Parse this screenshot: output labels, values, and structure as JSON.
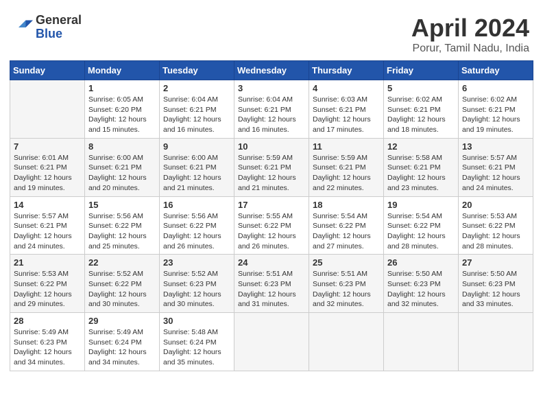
{
  "header": {
    "logo_general": "General",
    "logo_blue": "Blue",
    "month_title": "April 2024",
    "location": "Porur, Tamil Nadu, India"
  },
  "calendar": {
    "days_of_week": [
      "Sunday",
      "Monday",
      "Tuesday",
      "Wednesday",
      "Thursday",
      "Friday",
      "Saturday"
    ],
    "weeks": [
      {
        "cells": [
          {
            "day": "",
            "empty": true
          },
          {
            "day": "1",
            "sunrise": "Sunrise: 6:05 AM",
            "sunset": "Sunset: 6:20 PM",
            "daylight": "Daylight: 12 hours and 15 minutes."
          },
          {
            "day": "2",
            "sunrise": "Sunrise: 6:04 AM",
            "sunset": "Sunset: 6:21 PM",
            "daylight": "Daylight: 12 hours and 16 minutes."
          },
          {
            "day": "3",
            "sunrise": "Sunrise: 6:04 AM",
            "sunset": "Sunset: 6:21 PM",
            "daylight": "Daylight: 12 hours and 16 minutes."
          },
          {
            "day": "4",
            "sunrise": "Sunrise: 6:03 AM",
            "sunset": "Sunset: 6:21 PM",
            "daylight": "Daylight: 12 hours and 17 minutes."
          },
          {
            "day": "5",
            "sunrise": "Sunrise: 6:02 AM",
            "sunset": "Sunset: 6:21 PM",
            "daylight": "Daylight: 12 hours and 18 minutes."
          },
          {
            "day": "6",
            "sunrise": "Sunrise: 6:02 AM",
            "sunset": "Sunset: 6:21 PM",
            "daylight": "Daylight: 12 hours and 19 minutes."
          }
        ]
      },
      {
        "cells": [
          {
            "day": "7",
            "sunrise": "Sunrise: 6:01 AM",
            "sunset": "Sunset: 6:21 PM",
            "daylight": "Daylight: 12 hours and 19 minutes."
          },
          {
            "day": "8",
            "sunrise": "Sunrise: 6:00 AM",
            "sunset": "Sunset: 6:21 PM",
            "daylight": "Daylight: 12 hours and 20 minutes."
          },
          {
            "day": "9",
            "sunrise": "Sunrise: 6:00 AM",
            "sunset": "Sunset: 6:21 PM",
            "daylight": "Daylight: 12 hours and 21 minutes."
          },
          {
            "day": "10",
            "sunrise": "Sunrise: 5:59 AM",
            "sunset": "Sunset: 6:21 PM",
            "daylight": "Daylight: 12 hours and 21 minutes."
          },
          {
            "day": "11",
            "sunrise": "Sunrise: 5:59 AM",
            "sunset": "Sunset: 6:21 PM",
            "daylight": "Daylight: 12 hours and 22 minutes."
          },
          {
            "day": "12",
            "sunrise": "Sunrise: 5:58 AM",
            "sunset": "Sunset: 6:21 PM",
            "daylight": "Daylight: 12 hours and 23 minutes."
          },
          {
            "day": "13",
            "sunrise": "Sunrise: 5:57 AM",
            "sunset": "Sunset: 6:21 PM",
            "daylight": "Daylight: 12 hours and 24 minutes."
          }
        ]
      },
      {
        "cells": [
          {
            "day": "14",
            "sunrise": "Sunrise: 5:57 AM",
            "sunset": "Sunset: 6:21 PM",
            "daylight": "Daylight: 12 hours and 24 minutes."
          },
          {
            "day": "15",
            "sunrise": "Sunrise: 5:56 AM",
            "sunset": "Sunset: 6:22 PM",
            "daylight": "Daylight: 12 hours and 25 minutes."
          },
          {
            "day": "16",
            "sunrise": "Sunrise: 5:56 AM",
            "sunset": "Sunset: 6:22 PM",
            "daylight": "Daylight: 12 hours and 26 minutes."
          },
          {
            "day": "17",
            "sunrise": "Sunrise: 5:55 AM",
            "sunset": "Sunset: 6:22 PM",
            "daylight": "Daylight: 12 hours and 26 minutes."
          },
          {
            "day": "18",
            "sunrise": "Sunrise: 5:54 AM",
            "sunset": "Sunset: 6:22 PM",
            "daylight": "Daylight: 12 hours and 27 minutes."
          },
          {
            "day": "19",
            "sunrise": "Sunrise: 5:54 AM",
            "sunset": "Sunset: 6:22 PM",
            "daylight": "Daylight: 12 hours and 28 minutes."
          },
          {
            "day": "20",
            "sunrise": "Sunrise: 5:53 AM",
            "sunset": "Sunset: 6:22 PM",
            "daylight": "Daylight: 12 hours and 28 minutes."
          }
        ]
      },
      {
        "cells": [
          {
            "day": "21",
            "sunrise": "Sunrise: 5:53 AM",
            "sunset": "Sunset: 6:22 PM",
            "daylight": "Daylight: 12 hours and 29 minutes."
          },
          {
            "day": "22",
            "sunrise": "Sunrise: 5:52 AM",
            "sunset": "Sunset: 6:22 PM",
            "daylight": "Daylight: 12 hours and 30 minutes."
          },
          {
            "day": "23",
            "sunrise": "Sunrise: 5:52 AM",
            "sunset": "Sunset: 6:23 PM",
            "daylight": "Daylight: 12 hours and 30 minutes."
          },
          {
            "day": "24",
            "sunrise": "Sunrise: 5:51 AM",
            "sunset": "Sunset: 6:23 PM",
            "daylight": "Daylight: 12 hours and 31 minutes."
          },
          {
            "day": "25",
            "sunrise": "Sunrise: 5:51 AM",
            "sunset": "Sunset: 6:23 PM",
            "daylight": "Daylight: 12 hours and 32 minutes."
          },
          {
            "day": "26",
            "sunrise": "Sunrise: 5:50 AM",
            "sunset": "Sunset: 6:23 PM",
            "daylight": "Daylight: 12 hours and 32 minutes."
          },
          {
            "day": "27",
            "sunrise": "Sunrise: 5:50 AM",
            "sunset": "Sunset: 6:23 PM",
            "daylight": "Daylight: 12 hours and 33 minutes."
          }
        ]
      },
      {
        "cells": [
          {
            "day": "28",
            "sunrise": "Sunrise: 5:49 AM",
            "sunset": "Sunset: 6:23 PM",
            "daylight": "Daylight: 12 hours and 34 minutes."
          },
          {
            "day": "29",
            "sunrise": "Sunrise: 5:49 AM",
            "sunset": "Sunset: 6:24 PM",
            "daylight": "Daylight: 12 hours and 34 minutes."
          },
          {
            "day": "30",
            "sunrise": "Sunrise: 5:48 AM",
            "sunset": "Sunset: 6:24 PM",
            "daylight": "Daylight: 12 hours and 35 minutes."
          },
          {
            "day": "",
            "empty": true
          },
          {
            "day": "",
            "empty": true
          },
          {
            "day": "",
            "empty": true
          },
          {
            "day": "",
            "empty": true
          }
        ]
      }
    ]
  }
}
